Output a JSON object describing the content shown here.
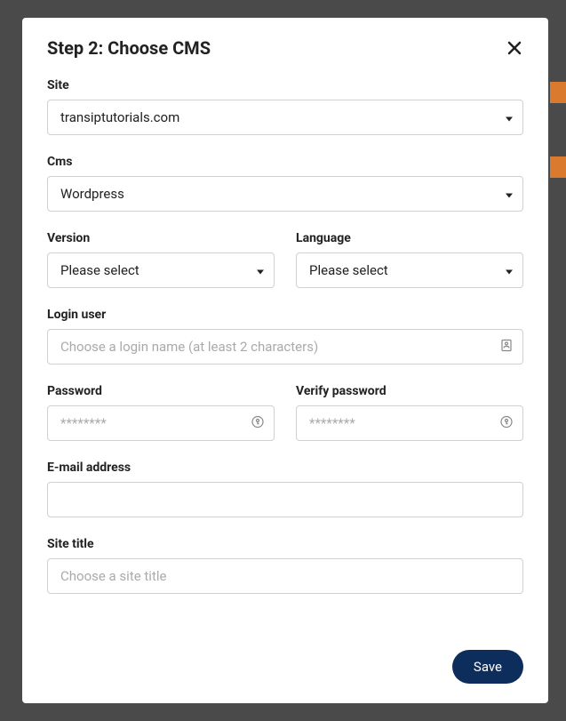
{
  "modal": {
    "title": "Step 2: Choose CMS",
    "site": {
      "label": "Site",
      "value": "transiptutorials.com"
    },
    "cms": {
      "label": "Cms",
      "value": "Wordpress"
    },
    "version": {
      "label": "Version",
      "value": "Please select"
    },
    "language": {
      "label": "Language",
      "value": "Please select"
    },
    "login_user": {
      "label": "Login user",
      "placeholder": "Choose a login name (at least 2 characters)"
    },
    "password": {
      "label": "Password",
      "placeholder": "********"
    },
    "verify_password": {
      "label": "Verify password",
      "placeholder": "********"
    },
    "email": {
      "label": "E-mail address"
    },
    "site_title": {
      "label": "Site title",
      "placeholder": "Choose a site title"
    },
    "save_label": "Save"
  }
}
